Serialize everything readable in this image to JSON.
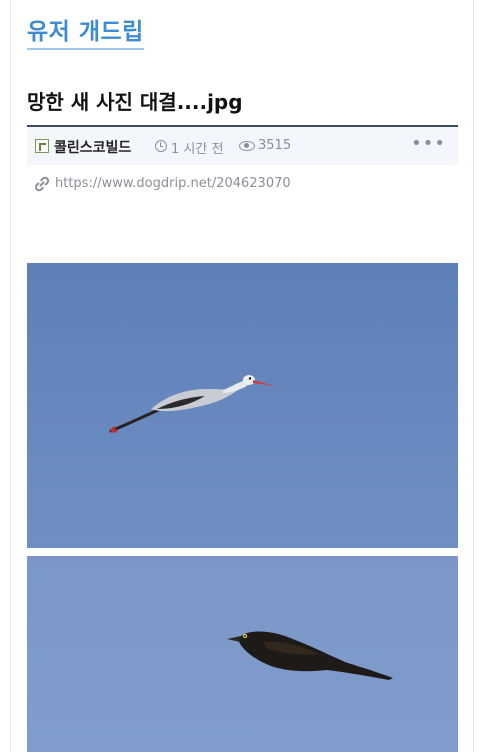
{
  "board": {
    "title": "유저 개드립"
  },
  "post": {
    "title": "망한 새 사진 대결....jpg",
    "author": "콜린스코빌드",
    "time": "1 시간 전",
    "views": "3515",
    "url": "https://www.dogdrip.net/204623070"
  },
  "icons": {
    "author": "author-level-icon",
    "time": "clock-icon",
    "views": "eye-icon",
    "more": "more-options-icon",
    "link": "link-icon"
  },
  "colors": {
    "accent": "#3d8cd1",
    "meta_text": "#8a8f99",
    "sky_top": "#5e80b8",
    "sky_bottom": "#6f8fc4"
  },
  "images": [
    {
      "subject": "stork-photo"
    },
    {
      "subject": "crow-photo"
    }
  ]
}
